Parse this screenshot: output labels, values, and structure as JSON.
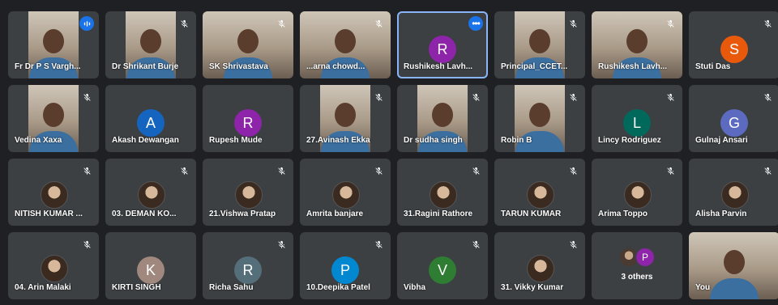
{
  "participants": [
    {
      "name": "Fr Dr P S Vargh...",
      "type": "video",
      "indicator": "speaking"
    },
    {
      "name": "Dr Shrikant Burje",
      "type": "video",
      "indicator": "mic-off"
    },
    {
      "name": "SK Shrivastava",
      "type": "video-wide",
      "indicator": "mic-off"
    },
    {
      "name": "...arna chowd...",
      "type": "video-wide",
      "indicator": "mic-off"
    },
    {
      "name": "Rushikesh Lavh...",
      "type": "letter",
      "letter": "R",
      "color": "#8e24aa",
      "indicator": "more",
      "active": true
    },
    {
      "name": "Principal_CCET...",
      "type": "video",
      "indicator": "mic-off"
    },
    {
      "name": "Rushikesh Lavh...",
      "type": "video-wide",
      "indicator": "mic-off"
    },
    {
      "name": "Stuti Das",
      "type": "letter",
      "letter": "S",
      "color": "#e8590c",
      "indicator": "mic-off"
    },
    {
      "name": "Vedina Xaxa",
      "type": "video",
      "indicator": "mic-off"
    },
    {
      "name": "Akash Dewangan",
      "type": "letter",
      "letter": "A",
      "color": "#1565c0",
      "indicator": "none"
    },
    {
      "name": "Rupesh Mude",
      "type": "letter",
      "letter": "R",
      "color": "#8e24aa",
      "indicator": "none"
    },
    {
      "name": "27.Avinash Ekka",
      "type": "video",
      "indicator": "mic-off"
    },
    {
      "name": "Dr sudha singh",
      "type": "video",
      "indicator": "mic-off"
    },
    {
      "name": "Robin B",
      "type": "video",
      "indicator": "mic-off"
    },
    {
      "name": "Lincy Rodriguez",
      "type": "letter",
      "letter": "L",
      "color": "#00695c",
      "indicator": "mic-off"
    },
    {
      "name": "Gulnaj Ansari",
      "type": "letter",
      "letter": "G",
      "color": "#5c6bc0",
      "indicator": "mic-off"
    },
    {
      "name": "NITISH KUMAR ...",
      "type": "photo",
      "indicator": "mic-off"
    },
    {
      "name": "03. DEMAN KO...",
      "type": "photo",
      "indicator": "mic-off"
    },
    {
      "name": "21.Vishwa Pratap",
      "type": "photo",
      "indicator": "mic-off"
    },
    {
      "name": "Amrita banjare",
      "type": "photo",
      "indicator": "mic-off"
    },
    {
      "name": "31.Ragini Rathore",
      "type": "photo",
      "indicator": "mic-off"
    },
    {
      "name": "TARUN KUMAR",
      "type": "photo",
      "indicator": "mic-off"
    },
    {
      "name": "Arima Toppo",
      "type": "photo",
      "indicator": "mic-off"
    },
    {
      "name": "Alisha Parvin",
      "type": "photo",
      "indicator": "mic-off"
    },
    {
      "name": "04. Arin Malaki",
      "type": "photo",
      "indicator": "mic-off"
    },
    {
      "name": "KIRTI SINGH",
      "type": "letter",
      "letter": "K",
      "color": "#a1887f",
      "indicator": "none"
    },
    {
      "name": "Richa Sahu",
      "type": "letter",
      "letter": "R",
      "color": "#546e7a",
      "indicator": "mic-off"
    },
    {
      "name": "10.Deepika Patel",
      "type": "letter",
      "letter": "P",
      "color": "#0288d1",
      "indicator": "mic-off"
    },
    {
      "name": "Vibha",
      "type": "letter",
      "letter": "V",
      "color": "#2e7d32",
      "indicator": "mic-off"
    },
    {
      "name": "31. Vikky Kumar",
      "type": "photo",
      "indicator": "mic-off"
    },
    {
      "name": "3 others",
      "type": "others",
      "letter": "P",
      "color": "#8e24aa",
      "indicator": "none"
    },
    {
      "name": "You",
      "type": "video-wide",
      "indicator": "none"
    }
  ]
}
